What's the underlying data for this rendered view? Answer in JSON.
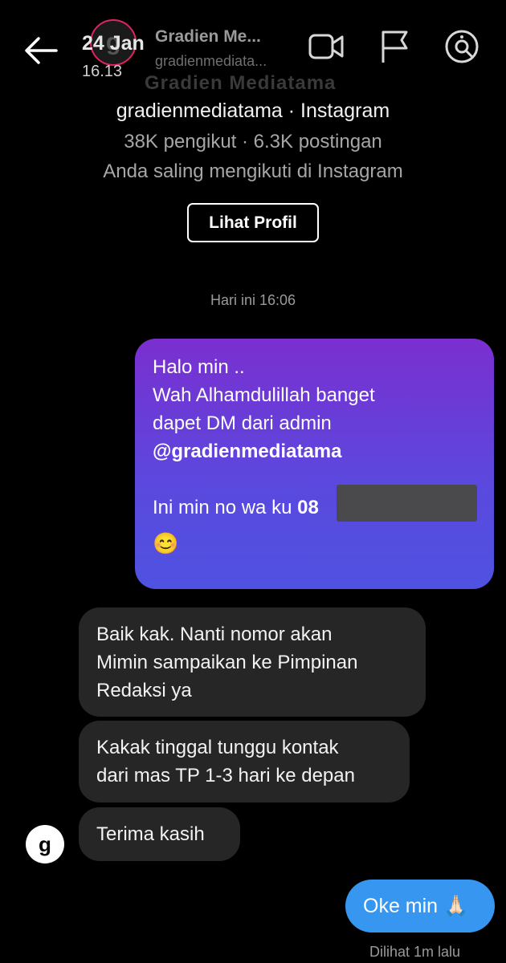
{
  "header": {
    "overlay_date": "24 Jan",
    "overlay_time": "16.13",
    "name": "Gradien Me...",
    "handle": "gradienmediata...",
    "ghost_name": "Gradien Mediatama"
  },
  "profile": {
    "handle_line": "gradienmediatama · Instagram",
    "stats_line": "38K pengikut · 6.3K postingan",
    "mutual_line": "Anda saling mengikuti di Instagram",
    "view_profile_label": "Lihat Profil"
  },
  "thread": {
    "timestamp": "Hari ini 16:06",
    "outgoing_1": {
      "line1": "Halo min ..",
      "line2": "Wah Alhamdulillah banget",
      "line3": "dapet DM dari admin",
      "mention": "@gradienmediatama",
      "line5": "Ini min no wa ku ",
      "phone_prefix": "08",
      "emoji": "😊"
    },
    "incoming_1_line1": "Baik kak. Nanti nomor akan",
    "incoming_1_line2": "Mimin sampaikan ke Pimpinan",
    "incoming_1_line3": "Redaksi ya",
    "incoming_2_line1": "Kakak tinggal tunggu kontak",
    "incoming_2_line2": "dari mas TP 1-3 hari ke depan",
    "incoming_3": "Terima kasih",
    "sender_avatar_letter": "g",
    "outgoing_2": "Oke min 🙏🏻",
    "seen_status": "Dilihat 1m lalu"
  },
  "colors": {
    "background": "#000000",
    "incoming_bubble": "#262626",
    "outgoing_gradient_top": "#7a2fd0",
    "outgoing_gradient_bottom": "#4f52e0",
    "outgoing_small": "#3797f0"
  },
  "icons": [
    "back-arrow-icon",
    "video-call-icon",
    "flag-icon",
    "search-in-chat-icon"
  ]
}
